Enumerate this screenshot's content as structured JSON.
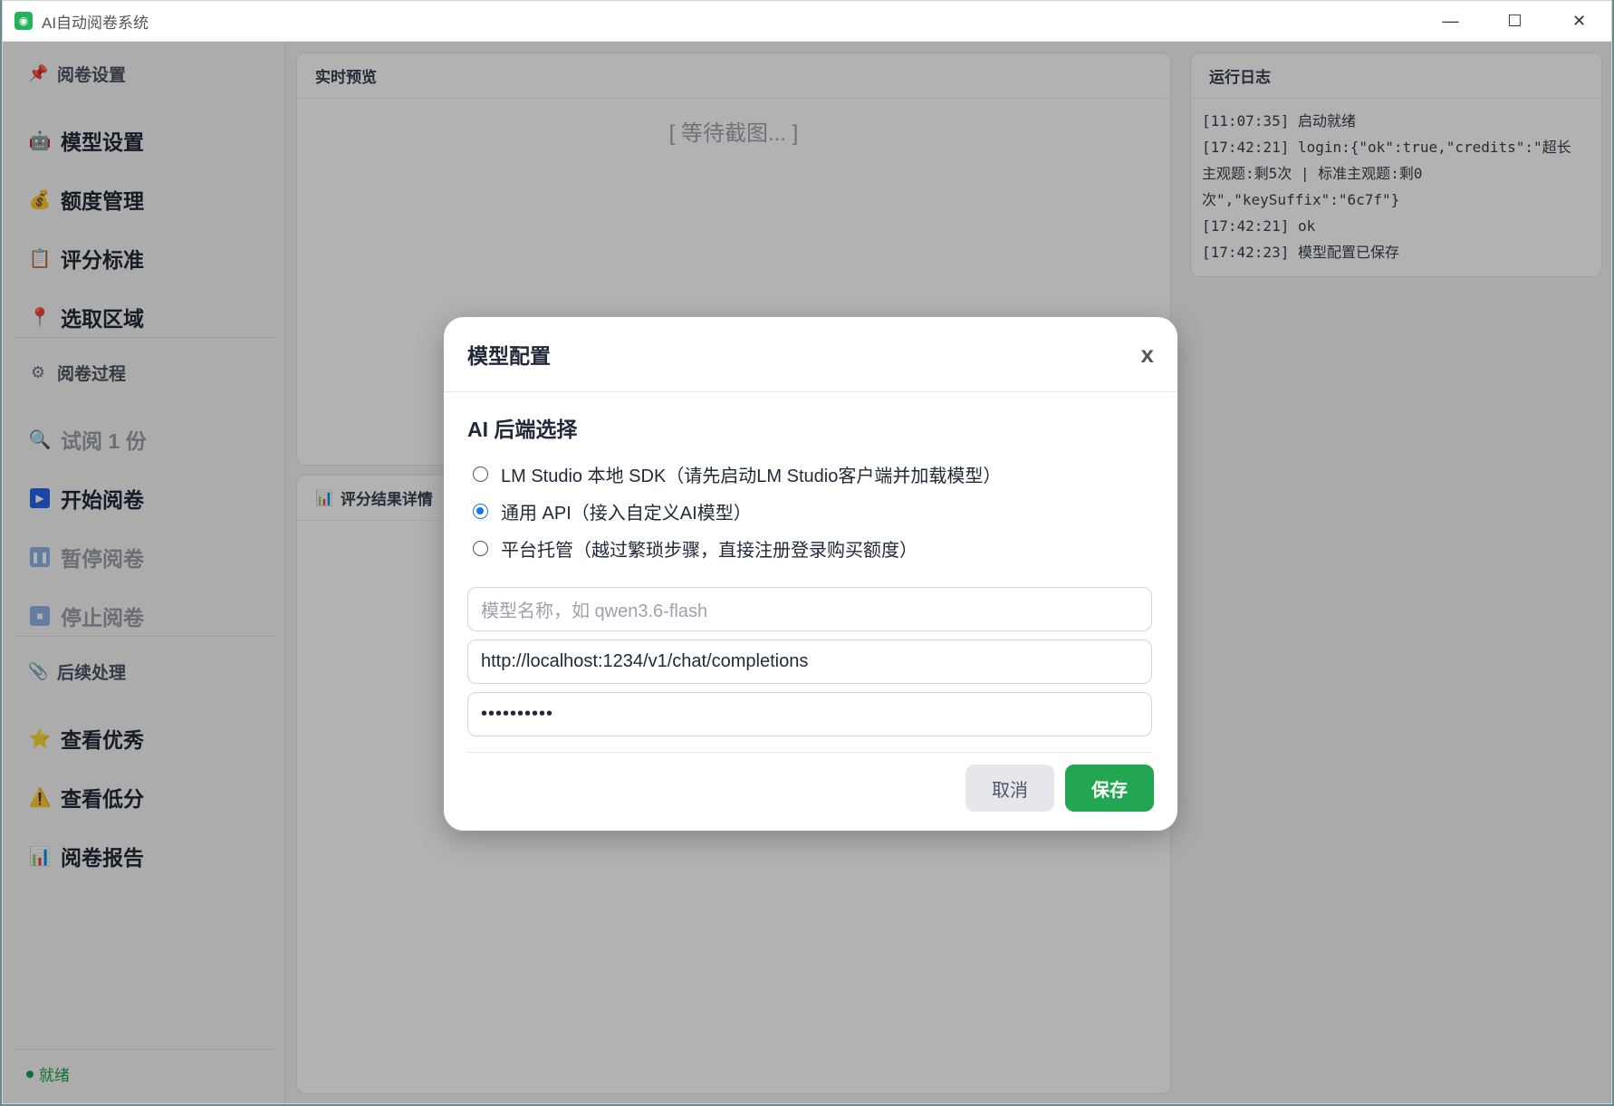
{
  "window": {
    "title": "AI自动阅卷系统",
    "minimize": "—",
    "maximize": "☐",
    "close": "✕"
  },
  "sidebar": {
    "section1": "阅卷设置",
    "model_settings": "模型设置",
    "quota": "额度管理",
    "criteria": "评分标准",
    "region": "选取区域",
    "section2": "阅卷过程",
    "trial": "试阅 1 份",
    "start": "开始阅卷",
    "pause": "暂停阅卷",
    "stop": "停止阅卷",
    "section3": "后续处理",
    "excellent": "查看优秀",
    "low": "查看低分",
    "report": "阅卷报告",
    "status": "就绪"
  },
  "preview": {
    "title": "实时预览",
    "waiting": "[ 等待截图... ]"
  },
  "results": {
    "title": "评分结果详情"
  },
  "log": {
    "title": "运行日志",
    "lines": [
      "[11:07:35] 启动就绪",
      "[17:42:21] login:{\"ok\":true,\"credits\":\"超长",
      "主观题:剩5次 | 标准主观题:剩0",
      "次\",\"keySuffix\":\"6c7f\"}",
      "[17:42:21] ok",
      "[17:42:23] 模型配置已保存"
    ]
  },
  "modal": {
    "title": "模型配置",
    "close": "x",
    "subtitle": "AI 后端选择",
    "options": [
      "LM Studio 本地 SDK（请先启动LM Studio客户端并加载模型）",
      "通用 API（接入自定义AI模型）",
      "平台托管（越过繁琐步骤，直接注册登录购买额度）"
    ],
    "selected_index": 1,
    "model_placeholder": "模型名称，如 qwen3.6-flash",
    "url_value": "http://localhost:1234/v1/chat/completions",
    "key_value": "••••••••••",
    "cancel": "取消",
    "save": "保存"
  },
  "colors": {
    "accent_green": "#22a652",
    "radio_blue": "#1a73e8",
    "status_green": "#16a34a"
  }
}
